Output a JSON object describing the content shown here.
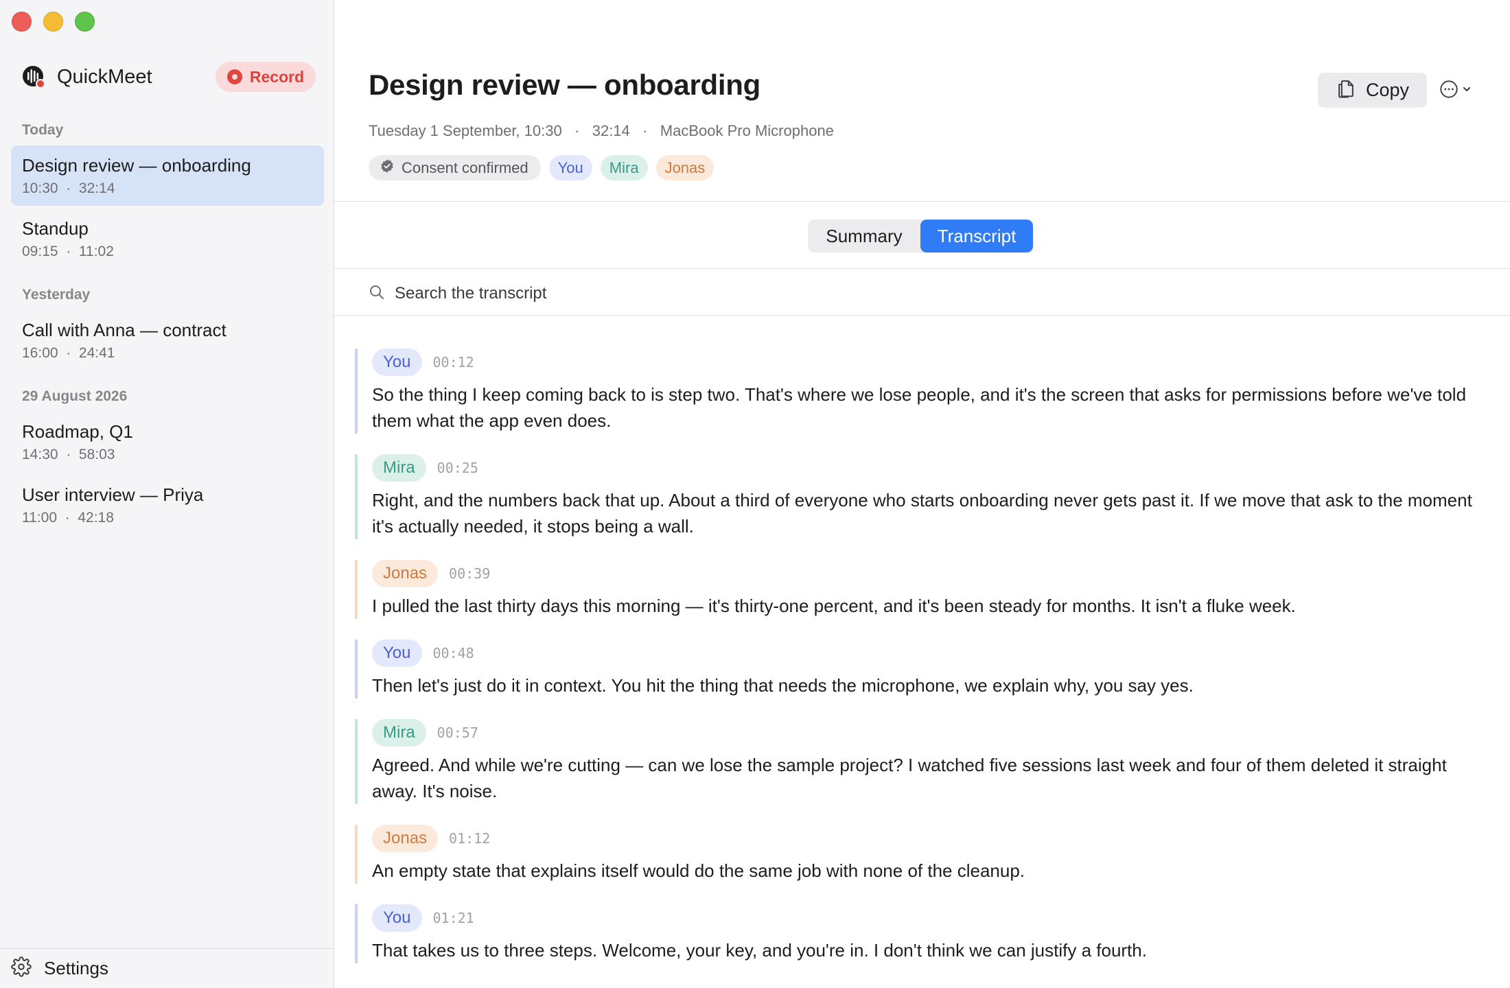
{
  "app": {
    "name": "QuickMeet",
    "record_label": "Record"
  },
  "sidebar": {
    "groups": [
      {
        "label": "Today"
      },
      {
        "label": "Yesterday"
      },
      {
        "label": "29 August 2026"
      }
    ],
    "meetings": [
      {
        "title": "Design review — onboarding",
        "time": "10:30",
        "duration": "32:14",
        "active": true
      },
      {
        "title": "Standup",
        "time": "09:15",
        "duration": "11:02"
      },
      {
        "title": "Call with Anna — contract",
        "time": "16:00",
        "duration": "24:41"
      },
      {
        "title": "Roadmap, Q1",
        "time": "14:30",
        "duration": "58:03"
      },
      {
        "title": "User interview — Priya",
        "time": "11:00",
        "duration": "42:18"
      }
    ],
    "separator": "·",
    "settings_label": "Settings"
  },
  "meeting": {
    "title": "Design review — onboarding",
    "date": "Tuesday 1 September, 10:30",
    "duration": "32:14",
    "source": "MacBook Pro Microphone",
    "consent_label": "Consent confirmed",
    "participants": [
      "You",
      "Mira",
      "Jonas"
    ]
  },
  "toolbar": {
    "copy_label": "Copy"
  },
  "tabs": {
    "summary": "Summary",
    "transcript": "Transcript",
    "active": "Transcript"
  },
  "search": {
    "placeholder": "Search the transcript"
  },
  "transcript": [
    {
      "speaker": "You",
      "time": "00:12",
      "text": "So the thing I keep coming back to is step two. That's where we lose people, and it's the screen that asks for permissions before we've told them what the app even does."
    },
    {
      "speaker": "Mira",
      "time": "00:25",
      "text": "Right, and the numbers back that up. About a third of everyone who starts onboarding never gets past it. If we move that ask to the moment it's actually needed, it stops being a wall."
    },
    {
      "speaker": "Jonas",
      "time": "00:39",
      "text": "I pulled the last thirty days this morning — it's thirty-one percent, and it's been steady for months. It isn't a fluke week."
    },
    {
      "speaker": "You",
      "time": "00:48",
      "text": "Then let's just do it in context. You hit the thing that needs the microphone, we explain why, you say yes."
    },
    {
      "speaker": "Mira",
      "time": "00:57",
      "text": "Agreed. And while we're cutting — can we lose the sample project? I watched five sessions last week and four of them deleted it straight away. It's noise."
    },
    {
      "speaker": "Jonas",
      "time": "01:12",
      "text": "An empty state that explains itself would do the same job with none of the cleanup."
    },
    {
      "speaker": "You",
      "time": "01:21",
      "text": "That takes us to three steps. Welcome, your key, and you're in. I don't think we can justify a fourth."
    }
  ],
  "colors": {
    "accent": "#2f7cf6",
    "record": "#d8453d",
    "you": "#4a62d0",
    "mira": "#3b9a84",
    "jonas": "#d07a3b"
  }
}
